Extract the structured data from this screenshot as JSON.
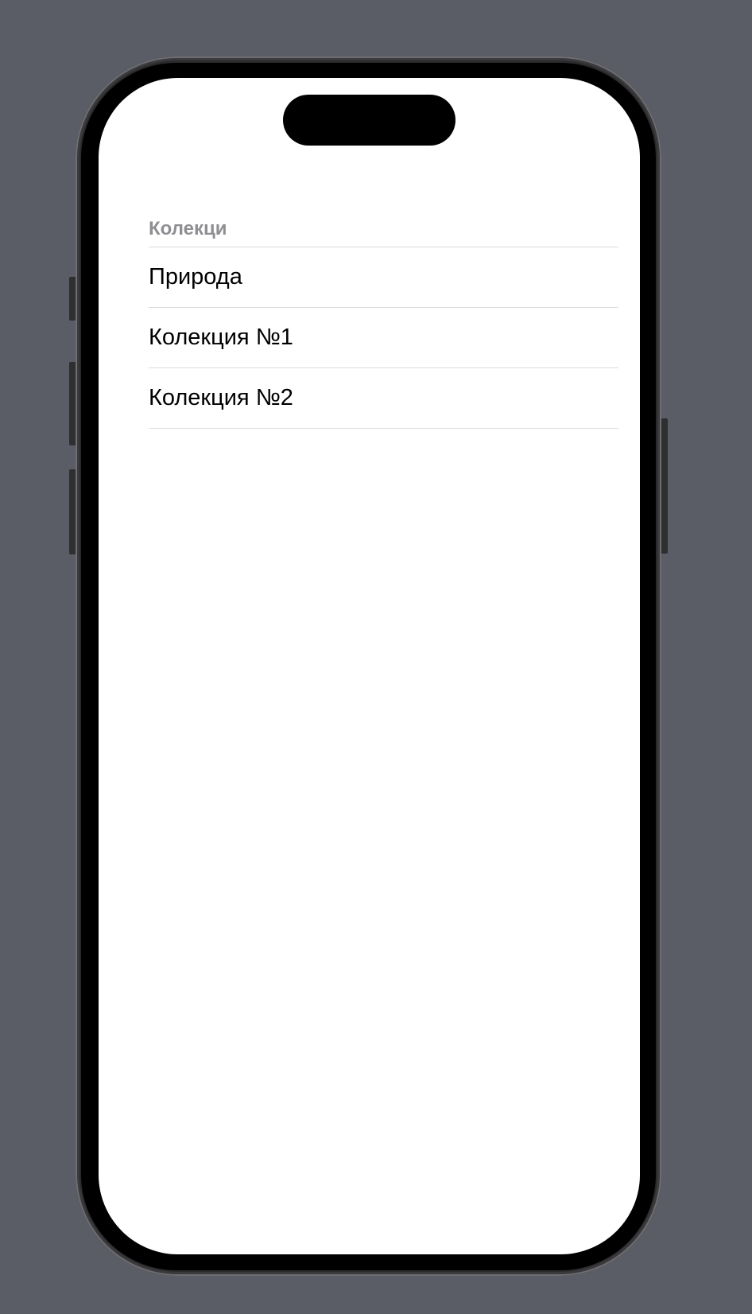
{
  "list": {
    "header": "Колекци",
    "items": [
      {
        "label": "Природа"
      },
      {
        "label": "Колекция №1"
      },
      {
        "label": "Колекция №2"
      }
    ]
  },
  "colors": {
    "background": "#5a5d65",
    "screen": "#ffffff",
    "header_text": "#8e8e93",
    "separator": "#dcdcdf"
  }
}
